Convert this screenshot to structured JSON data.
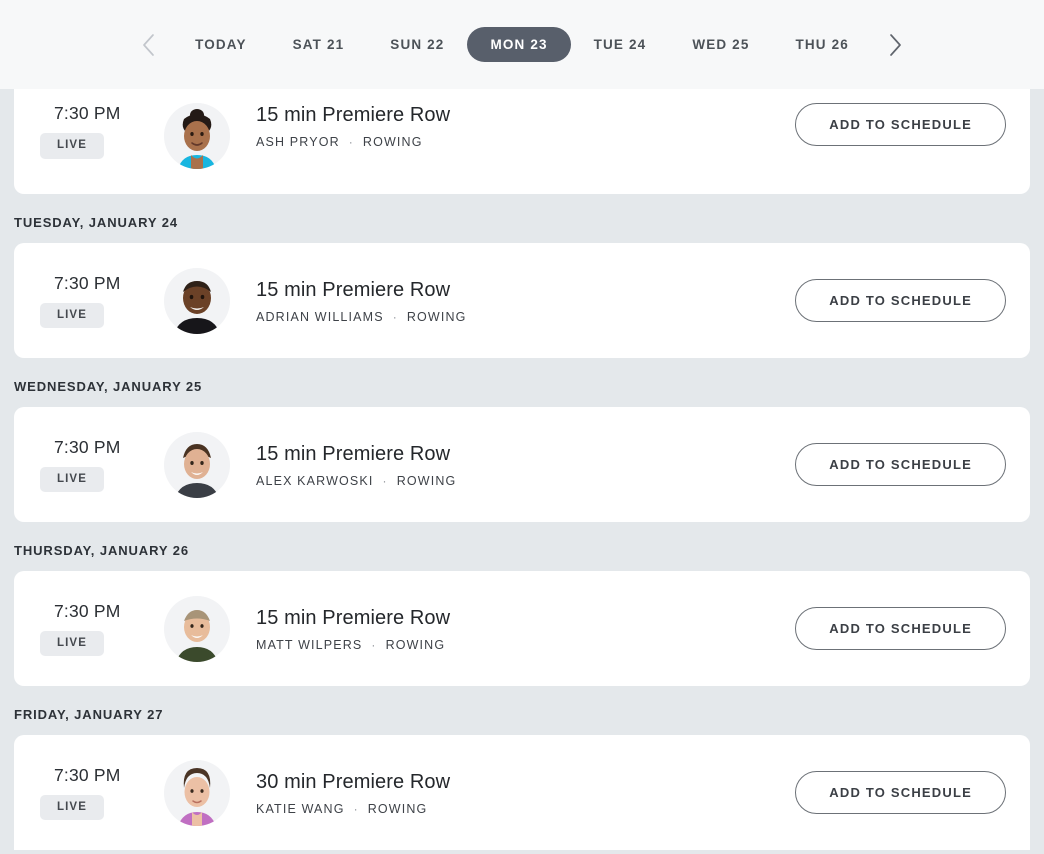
{
  "datenav": {
    "prev_label": "previous week",
    "next_label": "next week",
    "tabs": [
      {
        "label": "TODAY",
        "active": false
      },
      {
        "label": "SAT 21",
        "active": false
      },
      {
        "label": "SUN 22",
        "active": false
      },
      {
        "label": "MON 23",
        "active": true
      },
      {
        "label": "TUE 24",
        "active": false
      },
      {
        "label": "WED 25",
        "active": false
      },
      {
        "label": "THU 26",
        "active": false
      }
    ],
    "active_tab": "MON 23",
    "active_pill_color": "#585f6b"
  },
  "schedule": {
    "groups": [
      {
        "day_header": "",
        "clipped_top": true,
        "classes": [
          {
            "time": "7:30 PM",
            "badge": "LIVE",
            "title": "15 min Premiere Row",
            "instructor": "ASH PRYOR",
            "separator": "·",
            "discipline": "ROWING",
            "cta": "ADD TO SCHEDULE",
            "avatar": "instructor-avatar-ash-pryor"
          }
        ]
      },
      {
        "day_header": "TUESDAY, JANUARY 24",
        "clipped_top": false,
        "classes": [
          {
            "time": "7:30 PM",
            "badge": "LIVE",
            "title": "15 min Premiere Row",
            "instructor": "ADRIAN WILLIAMS",
            "separator": "·",
            "discipline": "ROWING",
            "cta": "ADD TO SCHEDULE",
            "avatar": "instructor-avatar-adrian-williams"
          }
        ]
      },
      {
        "day_header": "WEDNESDAY, JANUARY 25",
        "clipped_top": false,
        "classes": [
          {
            "time": "7:30 PM",
            "badge": "LIVE",
            "title": "15 min Premiere Row",
            "instructor": "ALEX KARWOSKI",
            "separator": "·",
            "discipline": "ROWING",
            "cta": "ADD TO SCHEDULE",
            "avatar": "instructor-avatar-alex-karwoski"
          }
        ]
      },
      {
        "day_header": "THURSDAY, JANUARY 26",
        "clipped_top": false,
        "classes": [
          {
            "time": "7:30 PM",
            "badge": "LIVE",
            "title": "15 min Premiere Row",
            "instructor": "MATT WILPERS",
            "separator": "·",
            "discipline": "ROWING",
            "cta": "ADD TO SCHEDULE",
            "avatar": "instructor-avatar-matt-wilpers"
          }
        ]
      },
      {
        "day_header": "FRIDAY, JANUARY 27",
        "clipped_top": false,
        "clipped_bottom": true,
        "classes": [
          {
            "time": "7:30 PM",
            "badge": "LIVE",
            "title": "30 min Premiere Row",
            "instructor": "KATIE WANG",
            "separator": "·",
            "discipline": "ROWING",
            "cta": "ADD TO SCHEDULE",
            "avatar": "instructor-avatar-katie-wang"
          }
        ]
      }
    ]
  },
  "colors": {
    "page_background": "#e4e8eb",
    "header_background": "#f7f8f9",
    "card_background": "#ffffff",
    "active_pill": "#585f6b",
    "badge_background": "#e9ebee",
    "text_primary": "#25282c"
  }
}
